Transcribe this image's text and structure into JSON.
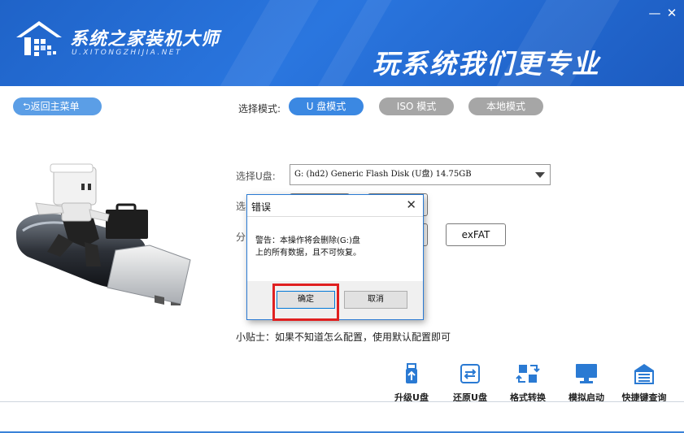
{
  "header": {
    "brand_title": "系统之家装机大师",
    "brand_url": "U.XITONGZHIJIA.NET",
    "slogan": "玩系统我们更专业",
    "minimize_glyph": "—",
    "close_glyph": "✕"
  },
  "nav": {
    "back_label": "⮌返回主菜单",
    "mode_label": "选择模式:",
    "modes": [
      {
        "label": "U 盘模式",
        "active": true
      },
      {
        "label": "ISO 模式",
        "active": false
      },
      {
        "label": "本地模式",
        "active": false
      }
    ]
  },
  "form": {
    "usb_label": "选择U盘:",
    "usb_value": "G: (hd2) Generic Flash Disk  (U盘) 14.75GB",
    "row2_label_fragment": "选",
    "row3_label_fragment": "分",
    "exfat_label": "exFAT"
  },
  "tip": "小贴士：如果不知道怎么配置，使用默认配置即可",
  "tools": [
    {
      "label": "升级U盘",
      "icon": "usb-upgrade-icon"
    },
    {
      "label": "还原U盘",
      "icon": "usb-restore-icon"
    },
    {
      "label": "格式转换",
      "icon": "format-convert-icon"
    },
    {
      "label": "模拟启动",
      "icon": "monitor-icon"
    },
    {
      "label": "快捷键查询",
      "icon": "keyboard-icon"
    }
  ],
  "dialog": {
    "title": "错误",
    "message_line1": "警告：本操作将会删除(G:)盘",
    "message_line2": "上的所有数据，且不可恢复。",
    "ok_label": "确定",
    "cancel_label": "取消",
    "close_glyph": "✕"
  },
  "colors": {
    "header_blue": "#2a76df",
    "active_tab": "#3b88e2",
    "inactive_tab": "#a6a6a6",
    "highlight_red": "#e02020"
  }
}
